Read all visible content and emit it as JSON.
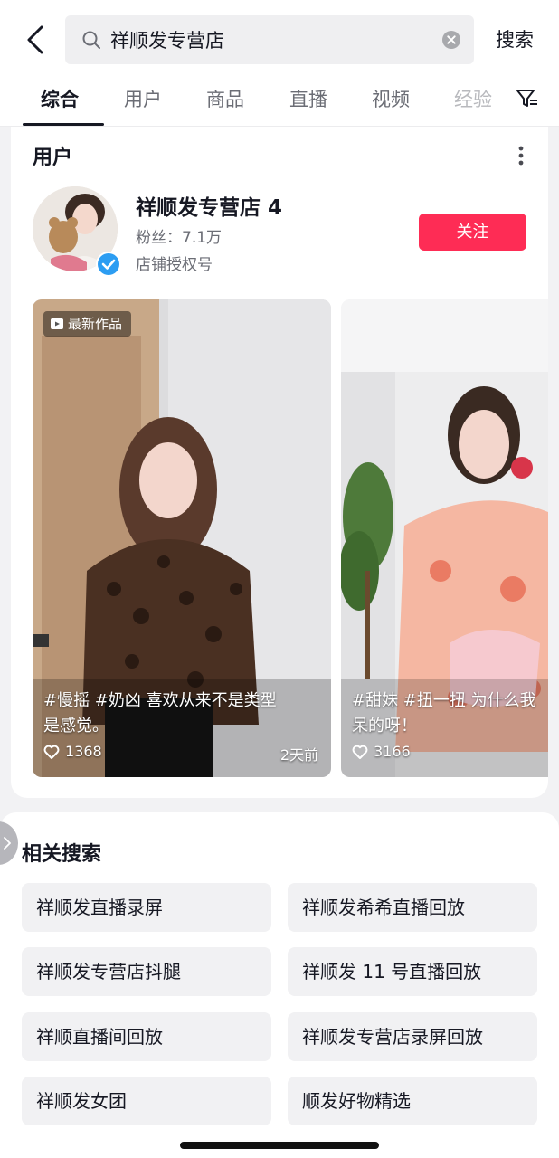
{
  "search": {
    "query": "祥顺发专营店",
    "submit_label": "搜索"
  },
  "tabs": [
    {
      "label": "综合",
      "active": true
    },
    {
      "label": "用户"
    },
    {
      "label": "商品"
    },
    {
      "label": "直播"
    },
    {
      "label": "视频"
    },
    {
      "label": "经验"
    }
  ],
  "user_section": {
    "title": "用户",
    "user": {
      "name": "祥顺发专营店 4",
      "fans": "粉丝：7.1万",
      "description": "店铺授权号",
      "verified": true
    },
    "follow_label": "关注",
    "follow_color": "#fe2c55"
  },
  "videos": [
    {
      "badge": "最新作品",
      "caption_line1": "#慢摇 #奶凶 喜欢从来不是类型",
      "caption_line2": "是感觉。",
      "likes": "1368",
      "time": "2天前"
    },
    {
      "caption_line1": "#甜妹 #扭一扭 为什么我",
      "caption_line2": "呆的呀！",
      "likes": "3166"
    }
  ],
  "related": {
    "title": "相关搜索",
    "items": [
      "祥顺发直播录屏",
      "祥顺发希希直播回放",
      "祥顺发专营店抖腿",
      "祥顺发 11 号直播回放",
      "祥顺直播间回放",
      "祥顺发专营店录屏回放",
      "祥顺发女团",
      "顺发好物精选"
    ]
  }
}
